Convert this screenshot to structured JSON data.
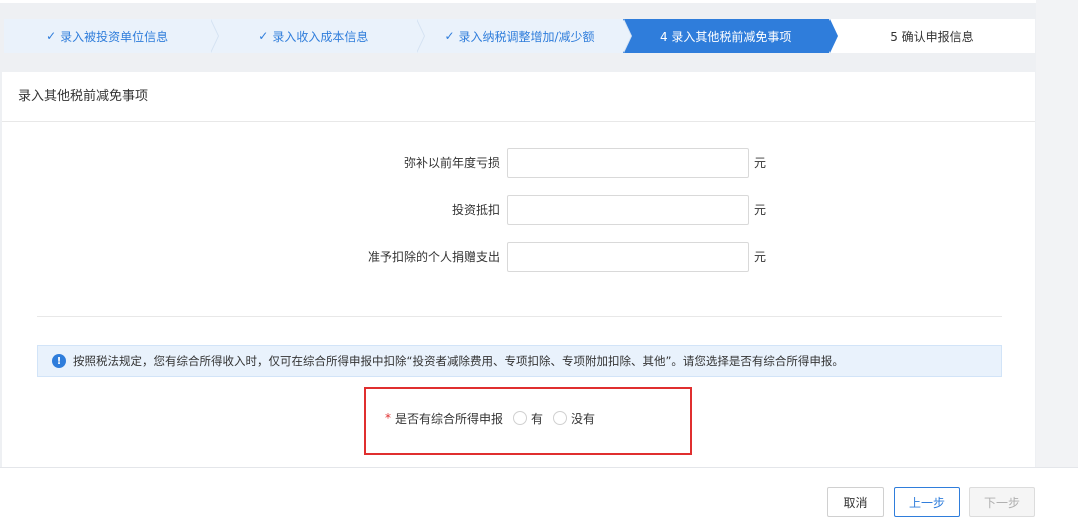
{
  "steps": [
    {
      "label": "录入被投资单位信息",
      "state": "done",
      "check": "✓"
    },
    {
      "label": "录入收入成本信息",
      "state": "done",
      "check": "✓"
    },
    {
      "label": "录入纳税调整增加/减少额",
      "state": "done",
      "check": "✓"
    },
    {
      "label": "4 录入其他税前减免事项",
      "state": "active"
    },
    {
      "label": "5 确认申报信息",
      "state": "pending"
    }
  ],
  "section": {
    "title": "录入其他税前减免事项"
  },
  "fields": [
    {
      "label": "弥补以前年度亏损",
      "value": "",
      "unit": "元"
    },
    {
      "label": "投资抵扣",
      "value": "",
      "unit": "元"
    },
    {
      "label": "准予扣除的个人捐赠支出",
      "value": "",
      "unit": "元"
    }
  ],
  "notice": {
    "icon": "info-icon",
    "icon_glyph": "!",
    "text": "按照税法规定，您有综合所得收入时，仅可在综合所得申报中扣除“投资者减除费用、专项扣除、专项附加扣除、其他”。请您选择是否有综合所得申报。"
  },
  "question": {
    "required_mark": "*",
    "label": "是否有综合所得申报",
    "options": [
      "有",
      "没有"
    ]
  },
  "footer": {
    "cancel": "取消",
    "prev": "上一步",
    "next": "下一步"
  },
  "colors": {
    "accent": "#2f7ddb",
    "highlight_border": "#e02f2f"
  }
}
